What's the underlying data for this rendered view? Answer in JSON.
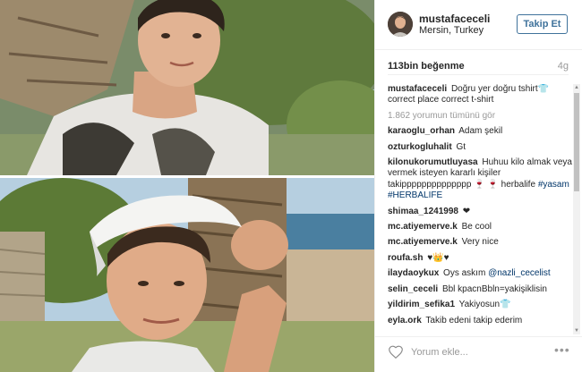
{
  "post": {
    "username": "mustafaceceli",
    "location": "Mersin, Turkey",
    "follow_label": "Takip Et",
    "likes": "113bin beğenme",
    "time": "4g",
    "caption_user": "mustafaceceli",
    "caption_text": "Doğru yer doğru tshirt👕 correct place correct t-shirt",
    "view_all": "1.862 yorumun tümünü gör"
  },
  "comments": [
    {
      "user": "karaoglu_orhan",
      "text": "Adam şekil"
    },
    {
      "user": "ozturkogluhalit",
      "text": "Gt"
    },
    {
      "user": "kilonukorumutluyasa",
      "text": "Huhuu kilo almak veya vermek isteyen kararlı kişiler takipppppppppppppp 🍷 🍷 herbalife",
      "tags": "#yasam #HERBALIFE"
    },
    {
      "user": "shimaa_1241998",
      "text": "❤"
    },
    {
      "user": "mc.atiyemerve.k",
      "text": "Be cool"
    },
    {
      "user": "mc.atiyemerve.k",
      "text": "Very nice"
    },
    {
      "user": "roufa.sh",
      "text": "♥👑♥"
    },
    {
      "user": "ilaydaoykux",
      "text": "Oys askım",
      "tags": "@nazli_cecelist"
    },
    {
      "user": "selin_ceceli",
      "text": "Bbl kpacnBbln=yakişiklisin"
    },
    {
      "user": "yildirim_sefika1",
      "text": "Yakiyosun👕"
    },
    {
      "user": "eyla.ork",
      "text": "Takib edeni takip ederim"
    }
  ],
  "footer": {
    "comment_placeholder": "Yorum ekle...",
    "more_label": "•••"
  },
  "icons": {
    "heart": "heart-icon",
    "more": "more-options-icon"
  },
  "colors": {
    "follow_button": "#3f729b",
    "tag": "#003569",
    "muted": "#999999"
  }
}
